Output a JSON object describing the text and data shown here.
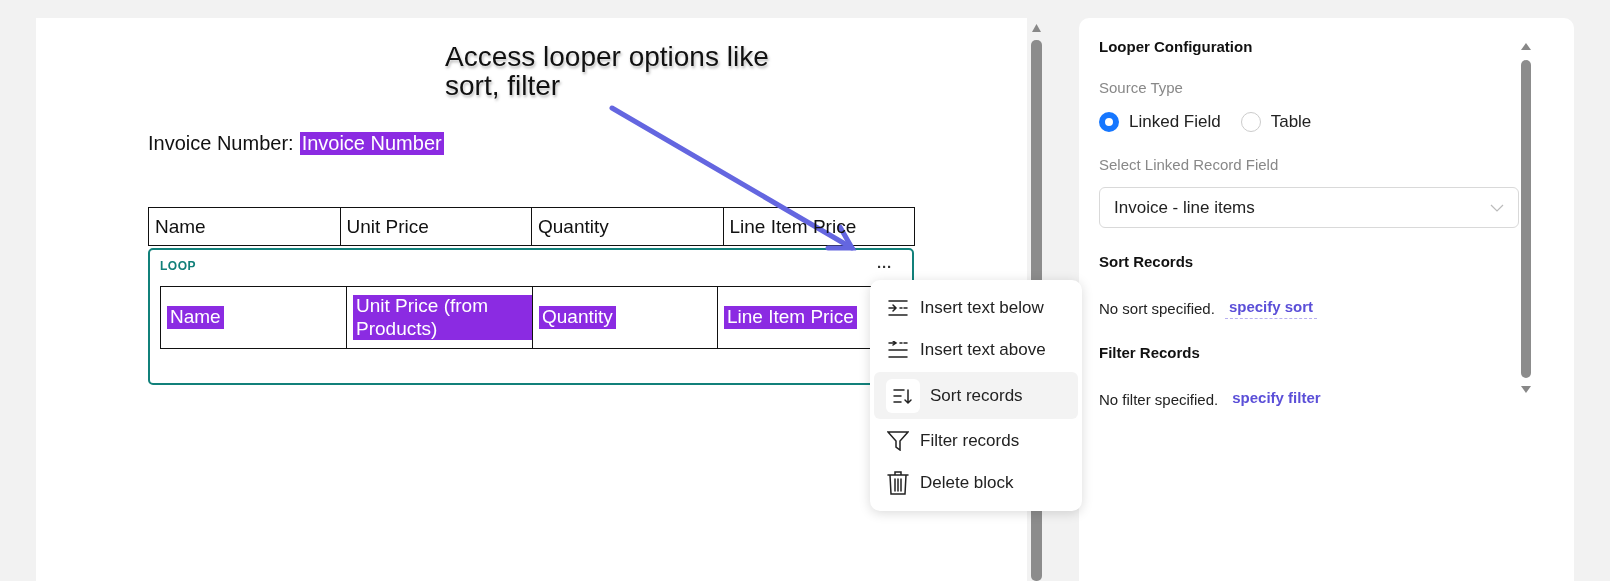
{
  "annotation": {
    "text": "Access looper options like sort, filter"
  },
  "document": {
    "invoice_label": "Invoice Number:",
    "invoice_field": "Invoice Number",
    "header_columns": [
      "Name",
      "Unit Price",
      "Quantity",
      "Line Item Price"
    ],
    "loop": {
      "label": "LOOP",
      "more_button": "···",
      "cells": [
        "Name",
        "Unit Price (from Products)",
        "Quantity",
        "Line Item Price"
      ]
    }
  },
  "context_menu": {
    "items": [
      {
        "label": "Insert text below",
        "kind": "insert_below",
        "selected": false
      },
      {
        "label": "Insert text above",
        "kind": "insert_above",
        "selected": false
      },
      {
        "label": "Sort records",
        "kind": "sort",
        "selected": true
      },
      {
        "label": "Filter records",
        "kind": "filter",
        "selected": false
      },
      {
        "label": "Delete block",
        "kind": "delete",
        "selected": false
      }
    ]
  },
  "config_panel": {
    "title": "Looper Configuration",
    "source_type_label": "Source Type",
    "source_options": [
      {
        "label": "Linked Field",
        "selected": true
      },
      {
        "label": "Table",
        "selected": false
      }
    ],
    "select_label": "Select Linked Record Field",
    "select_value": "Invoice - line items",
    "sections": [
      {
        "title": "Sort Records",
        "text": "No sort specified.",
        "link": "specify sort",
        "dashed": true
      },
      {
        "title": "Filter Records",
        "text": "No filter specified.",
        "link": "specify filter",
        "dashed": false
      }
    ]
  }
}
